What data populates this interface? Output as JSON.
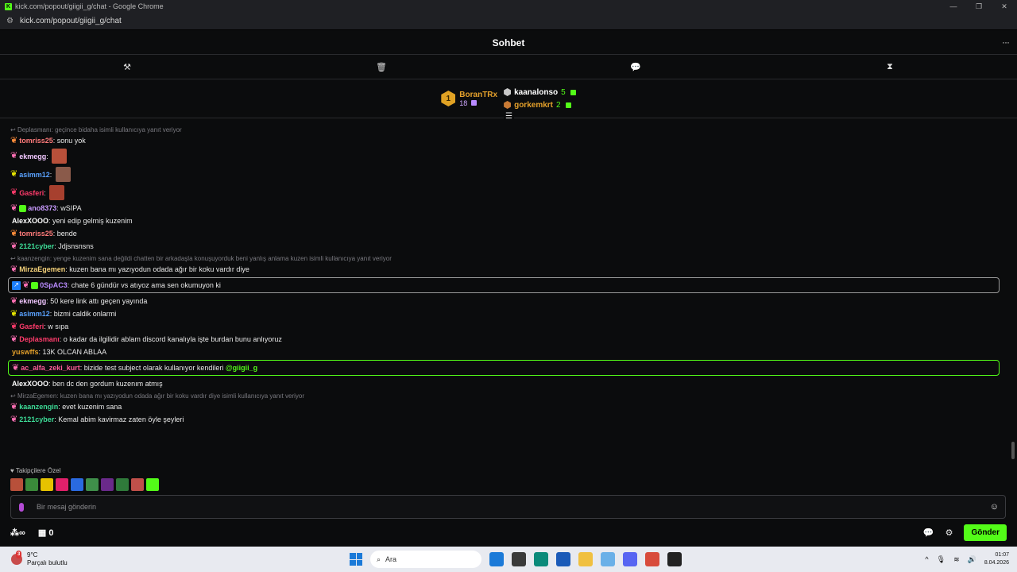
{
  "window": {
    "title": "kick.com/popout/giigii_g/chat - Google Chrome",
    "url": "kick.com/popout/giigii_g/chat",
    "controls": [
      "—",
      "❐",
      "✕"
    ]
  },
  "header": {
    "title": "Sohbet",
    "more": "···"
  },
  "toolbar": [
    "pin",
    "trash",
    "chat",
    "hourglass"
  ],
  "gifters": {
    "top": {
      "rank": "1",
      "name": "BoranTRx",
      "count": "18"
    },
    "others": [
      {
        "name": "kaanalonso",
        "count": "5",
        "color": "#ffffff"
      },
      {
        "name": "gorkemkrt",
        "count": "2",
        "color": "#e5a12b"
      }
    ]
  },
  "messages": [
    {
      "reply": "Deplasmanı: geçince bidaha isimli kullanıcıya yanıt veriyor",
      "user": "tomriss25",
      "color": "#ff7b7b",
      "fly": "#ff8c3a",
      "text": "sonu yok"
    },
    {
      "user": "ekmegg",
      "color": "#f1c7ff",
      "fly": "#ff6fb4",
      "text": "",
      "emote": "#b8503a"
    },
    {
      "user": "asimm12",
      "color": "#5aa2ff",
      "fly": "#e6e600",
      "text": "",
      "emote": "#8a5a4a"
    },
    {
      "user": "Gasferi",
      "color": "#ff3b6b",
      "fly": "#ff3b6b",
      "text": "",
      "emote": "#a7402e"
    },
    {
      "user": "ano8373",
      "color": "#c99bff",
      "fly": "#ff6fb4",
      "sub": true,
      "text": "wSIPA"
    },
    {
      "user": "AlexXOOO",
      "color": "#ffffff",
      "text": "yeni edip gelmiş kuzenim"
    },
    {
      "user": "tomriss25",
      "color": "#ff7b7b",
      "fly": "#ff8c3a",
      "text": "bende"
    },
    {
      "user": "2121cyber",
      "color": "#3ddc97",
      "fly": "#ff6fb4",
      "text": "Jdjsnsnsns"
    },
    {
      "reply": "kaanzengin: yenge kuzenim sana değildi chatten bir arkadaşla konuşuyorduk beni yanlış anlama kuzen isimli kullanıcıya yanıt veriyor",
      "user": "MirzaEgemen",
      "color": "#f5d27a",
      "fly": "#ff6fb4",
      "text": "kuzen bana mı yazıyodun odada ağır bir koku vardır diye"
    },
    {
      "highlight": "gray",
      "user": "0SpAC3",
      "color": "#b98bff",
      "fly": "#ff6fb4",
      "vip": true,
      "sub": true,
      "text": "chate 6 gündür vs atıyoz ama sen okumuyon ki"
    },
    {
      "user": "ekmegg",
      "color": "#f1c7ff",
      "fly": "#ff6fb4",
      "text": "50 kere link attı geçen yayında"
    },
    {
      "user": "asimm12",
      "color": "#5aa2ff",
      "fly": "#e6e600",
      "text": "bizmi caldik onlarmi"
    },
    {
      "user": "Gasferi",
      "color": "#ff3b6b",
      "fly": "#ff3b6b",
      "text": "w sıpa"
    },
    {
      "user": "Deplasmanı",
      "color": "#ff3b6b",
      "fly": "#ff6fb4",
      "text": "o kadar da ilgilidir ablam discord kanalıyla işte burdan bunu anlıyoruz"
    },
    {
      "user": "yuswffs",
      "color": "#e5a12b",
      "text": "13K OLCAN ABLAA"
    },
    {
      "highlight": "green",
      "user": "ac_alfa_zeki_kurt",
      "color": "#ff5e9a",
      "fly": "#ff6fb4",
      "text": "bizide test subject olarak kullanıyor kendileri",
      "mention": "@giigii_g"
    },
    {
      "user": "AlexXOOO",
      "color": "#ffffff",
      "text": "ben dc den gordum kuzenım atmış"
    },
    {
      "reply": "MirzaEgemen: kuzen bana mı yazıyodun odada ağır bir koku vardır diye isimli kullanıcıya yanıt veriyor",
      "user": "kaanzengin",
      "color": "#3ddc97",
      "fly": "#ff6fb4",
      "text": "evet kuzenim sana"
    },
    {
      "user": "2121cyber",
      "color": "#3ddc97",
      "fly": "#ff6fb4",
      "text": "Kemal abim kavirmaz zaten öyle şeyleri"
    }
  ],
  "followers_label": "Takipçilere Özel",
  "emotes": [
    "#b8503a",
    "#3a8a3a",
    "#e6c200",
    "#e0206a",
    "#2a6ae0",
    "#3f8f4a",
    "#6a2a8a",
    "#2f7a3a",
    "#c0504a",
    "#53fc18"
  ],
  "input": {
    "placeholder": "Bir mesaj gönderin"
  },
  "bottom": {
    "points": "∞",
    "gifts": "0",
    "send_label": "Gönder"
  },
  "taskbar": {
    "weather_temp": "9°C",
    "weather_desc": "Parçalı bulutlu",
    "weather_badge": "3",
    "search_label": "Ara",
    "time": "01:07",
    "date": "8.04.2026",
    "apps": [
      "#1b7ad8",
      "#3a3a3a",
      "#0a8a7a",
      "#1a5ab8",
      "#f0c040",
      "#6ab0e8",
      "#5865f2",
      "#d84b3b",
      "#222222"
    ]
  }
}
